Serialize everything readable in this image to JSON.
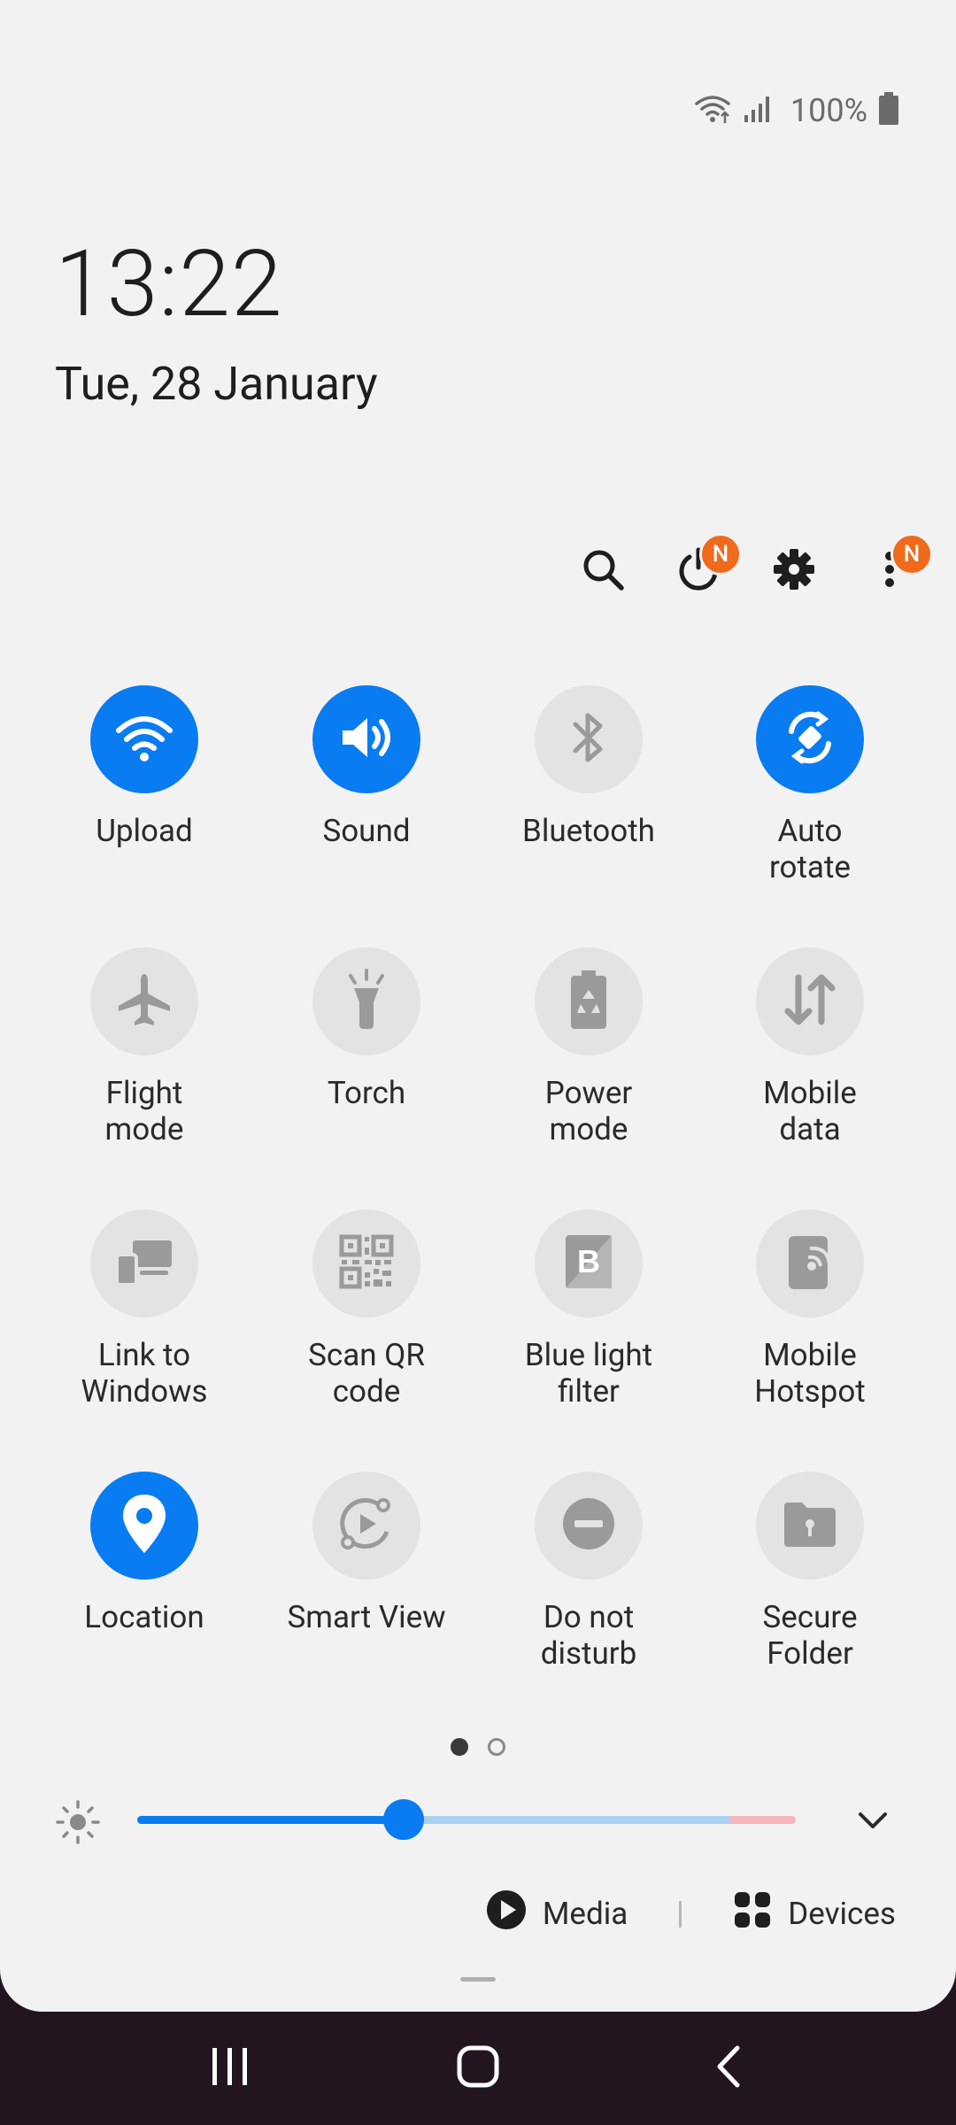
{
  "status_bar": {
    "battery_text": "100%",
    "icons": [
      "wifi-icon",
      "signal-icon",
      "battery-icon"
    ]
  },
  "clock": {
    "time": "13:22",
    "date": "Tue, 28 January"
  },
  "top_actions": {
    "icons": [
      "search-icon",
      "power-icon",
      "settings-icon",
      "more-options-icon"
    ],
    "power_badge": "N",
    "more_badge": "N"
  },
  "tiles": [
    {
      "id": "upload",
      "label": "Upload",
      "icon": "wifi-icon",
      "on": true
    },
    {
      "id": "sound",
      "label": "Sound",
      "icon": "speaker-icon",
      "on": true
    },
    {
      "id": "bluetooth",
      "label": "Bluetooth",
      "icon": "bluetooth-icon",
      "on": false
    },
    {
      "id": "auto-rotate",
      "label": "Auto\nrotate",
      "icon": "rotate-icon",
      "on": true
    },
    {
      "id": "flight-mode",
      "label": "Flight\nmode",
      "icon": "airplane-icon",
      "on": false
    },
    {
      "id": "torch",
      "label": "Torch",
      "icon": "flashlight-icon",
      "on": false
    },
    {
      "id": "power-mode",
      "label": "Power\nmode",
      "icon": "battery-recycle-icon",
      "on": false
    },
    {
      "id": "mobile-data",
      "label": "Mobile\ndata",
      "icon": "data-arrows-icon",
      "on": false
    },
    {
      "id": "link-to-windows",
      "label": "Link to\nWindows",
      "icon": "link-windows-icon",
      "on": false
    },
    {
      "id": "scan-qr",
      "label": "Scan QR\ncode",
      "icon": "qr-code-icon",
      "on": false
    },
    {
      "id": "blue-light",
      "label": "Blue light\nfilter",
      "icon": "blue-light-icon",
      "on": false
    },
    {
      "id": "hotspot",
      "label": "Mobile\nHotspot",
      "icon": "hotspot-icon",
      "on": false
    },
    {
      "id": "location",
      "label": "Location",
      "icon": "location-pin-icon",
      "on": true
    },
    {
      "id": "smart-view",
      "label": "Smart View",
      "icon": "smart-view-icon",
      "on": false
    },
    {
      "id": "dnd",
      "label": "Do not\ndisturb",
      "icon": "minus-circle-icon",
      "on": false
    },
    {
      "id": "secure-folder",
      "label": "Secure\nFolder",
      "icon": "secure-folder-icon",
      "on": false
    }
  ],
  "pager": {
    "pages": 2,
    "active": 0
  },
  "brightness": {
    "level": 0.405,
    "warn_fraction": 0.1
  },
  "bottom_row": {
    "media_label": "Media",
    "devices_label": "Devices"
  },
  "colors": {
    "accent": "#0a7cf2",
    "tile_off": "#e3e3e3",
    "badge": "#f06a1c",
    "nav_bg": "#23151f"
  }
}
